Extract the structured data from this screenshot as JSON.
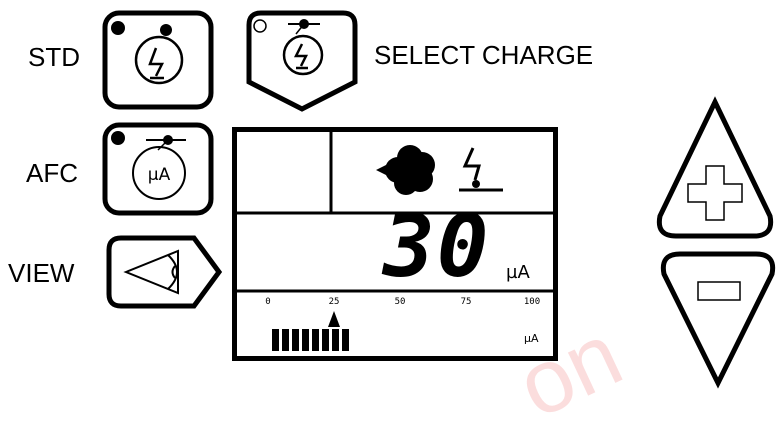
{
  "labels": {
    "std": "STD",
    "afc": "AFC",
    "view": "VIEW",
    "select_charge": "SELECT CHARGE"
  },
  "display": {
    "value": "30",
    "unit": "µA",
    "bar_unit": "µA",
    "scale_ticks": [
      "0",
      "25",
      "50",
      "75",
      "100"
    ],
    "bar_level_percent": 30,
    "pointer_at": "25"
  },
  "icons": {
    "std": "lightning-circle-icon",
    "select_charge": "lightning-selector-icon",
    "afc": "microamp-circle-icon",
    "view": "eye-icon",
    "plus": "plus-icon",
    "minus": "minus-icon",
    "cloud": "cloud-icon",
    "charge": "lightning-ground-icon"
  },
  "watermark": "on",
  "colors": {
    "stroke": "#000000",
    "watermark": "#f4a0a0"
  }
}
